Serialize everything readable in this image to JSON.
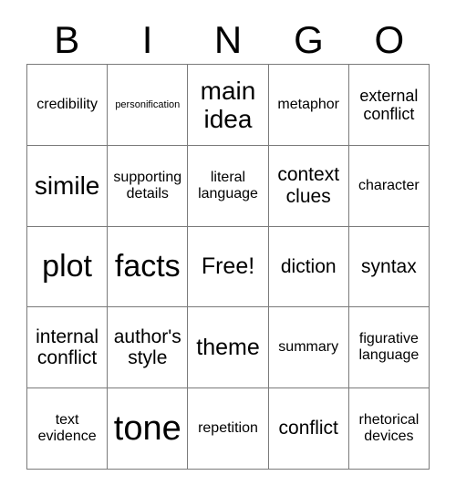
{
  "card": {
    "title": "BINGO",
    "header_letters": [
      "B",
      "I",
      "N",
      "G",
      "O"
    ],
    "columns": 5,
    "rows": 5,
    "border_color": "#7a7a7a",
    "text_color": "#000000",
    "background_color": "#ffffff"
  },
  "cells": [
    {
      "text": "credibility",
      "size": "sm"
    },
    {
      "text": "personification",
      "size": "xxs"
    },
    {
      "text": "main idea",
      "size": "xxl"
    },
    {
      "text": "metaphor",
      "size": "sm"
    },
    {
      "text": "external conflict",
      "size": "md"
    },
    {
      "text": "simile",
      "size": "xxl"
    },
    {
      "text": "supporting details",
      "size": "sm"
    },
    {
      "text": "literal language",
      "size": "sm"
    },
    {
      "text": "context clues",
      "size": "lg"
    },
    {
      "text": "character",
      "size": "sm"
    },
    {
      "text": "plot",
      "size": "huge"
    },
    {
      "text": "facts",
      "size": "huge"
    },
    {
      "text": "Free!",
      "size": "xl"
    },
    {
      "text": "diction",
      "size": "lg"
    },
    {
      "text": "syntax",
      "size": "lg"
    },
    {
      "text": "internal conflict",
      "size": "lg"
    },
    {
      "text": "author's style",
      "size": "lg"
    },
    {
      "text": "theme",
      "size": "xl"
    },
    {
      "text": "summary",
      "size": "sm"
    },
    {
      "text": "figurative language",
      "size": "sm"
    },
    {
      "text": "text evidence",
      "size": "sm"
    },
    {
      "text": "tone",
      "size": "mega"
    },
    {
      "text": "repetition",
      "size": "sm"
    },
    {
      "text": "conflict",
      "size": "lg"
    },
    {
      "text": "rhetorical devices",
      "size": "sm"
    }
  ]
}
